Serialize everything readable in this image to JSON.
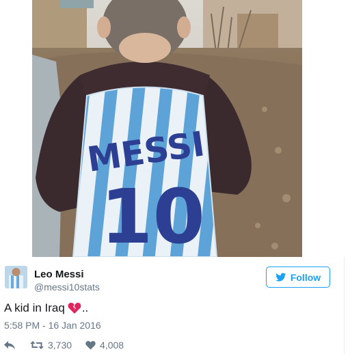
{
  "tweet": {
    "user": {
      "name": "Leo Messi",
      "handle": "@messi10stats"
    },
    "follow_label": "Follow",
    "text": "A kid in Iraq",
    "text_suffix": "..",
    "timestamp": "5:58 PM - 16 Jan 2016",
    "retweets": "3,730",
    "likes": "4,008"
  },
  "photo": {
    "jersey_text": "MESSI",
    "jersey_number": "10"
  },
  "icons": {
    "follow": "twitter-bird-icon",
    "emoji": "broken-heart-icon",
    "reply": "reply-icon",
    "retweet": "retweet-icon",
    "like": "heart-icon"
  },
  "colors": {
    "accent": "#1da1f2",
    "muted": "#657786",
    "text": "#14171a",
    "heart": "#e0245e"
  }
}
